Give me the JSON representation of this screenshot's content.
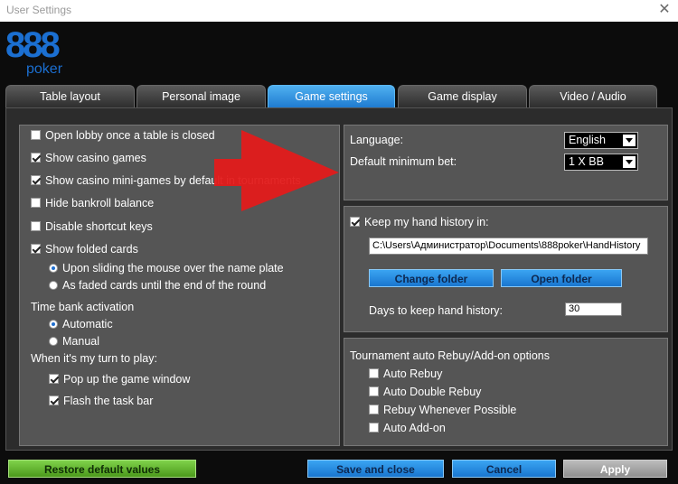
{
  "window": {
    "title": "User Settings",
    "close_glyph": "✕"
  },
  "logo": {
    "digits": "888",
    "word": "poker"
  },
  "tabs": [
    {
      "label": "Table layout",
      "active": false
    },
    {
      "label": "Personal image",
      "active": false
    },
    {
      "label": "Game settings",
      "active": true
    },
    {
      "label": "Game display",
      "active": false
    },
    {
      "label": "Video / Audio",
      "active": false
    }
  ],
  "left": {
    "open_lobby": {
      "label": "Open lobby once a table is closed",
      "checked": false
    },
    "show_casino_games": {
      "label": "Show casino games",
      "checked": true
    },
    "show_mini_games": {
      "label": "Show casino mini-games by default in tournaments",
      "checked": true
    },
    "hide_bankroll": {
      "label": "Hide bankroll balance",
      "checked": false
    },
    "disable_shortcuts": {
      "label": "Disable shortcut keys",
      "checked": false
    },
    "show_folded": {
      "label": "Show folded cards",
      "checked": true
    },
    "folded_opt1": {
      "label": "Upon sliding the mouse over the name plate",
      "selected": true
    },
    "folded_opt2": {
      "label": "As faded cards until the end of the round",
      "selected": false
    },
    "time_bank_label": "Time bank activation",
    "tb_auto": {
      "label": "Automatic",
      "selected": true
    },
    "tb_manual": {
      "label": "Manual",
      "selected": false
    },
    "my_turn_label": "When it's my turn to play:",
    "popup_window": {
      "label": "Pop up the game window",
      "checked": true
    },
    "flash_taskbar": {
      "label": "Flash the task bar",
      "checked": true
    }
  },
  "right_top": {
    "language_label": "Language:",
    "language_value": "English",
    "min_bet_label": "Default minimum bet:",
    "min_bet_value": "1 X BB"
  },
  "right_mid": {
    "keep_history": {
      "label": "Keep my hand history in:",
      "checked": true
    },
    "history_path": "C:\\Users\\Администратор\\Documents\\888poker\\HandHistory",
    "change_folder": "Change folder",
    "open_folder": "Open folder",
    "days_label": "Days to keep hand history:",
    "days_value": "30"
  },
  "right_bottom": {
    "heading": "Tournament auto Rebuy/Add-on options",
    "auto_rebuy": {
      "label": "Auto Rebuy",
      "checked": false
    },
    "auto_double_rebuy": {
      "label": "Auto Double Rebuy",
      "checked": false
    },
    "rebuy_whenever": {
      "label": "Rebuy Whenever Possible",
      "checked": false
    },
    "auto_addon": {
      "label": "Auto Add-on",
      "checked": false
    }
  },
  "footer": {
    "restore": "Restore default values",
    "save": "Save and close",
    "cancel": "Cancel",
    "apply": "Apply"
  },
  "colors": {
    "accent_blue": "#1f7bd0",
    "restore_green": "#5cab2a",
    "annotation_red": "#e31b1b",
    "panel_gray": "#555555"
  }
}
